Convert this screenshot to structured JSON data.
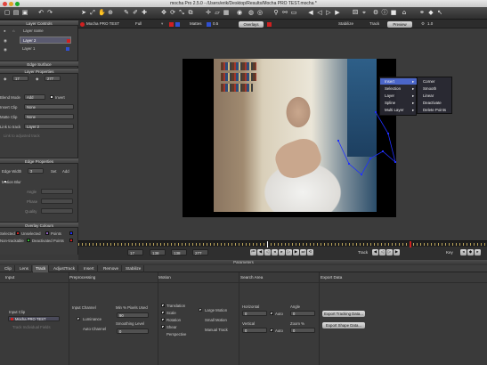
{
  "window": {
    "title": "mocha Pro 2.5.0 - /Users/erik/Desktop/Results/Mocha PRO TEST.mocha *"
  },
  "colors": {
    "accent_red": "#d02020",
    "accent_blue": "#3050d0",
    "spline": "#2030ff",
    "timeline_key": "#d9b94a"
  },
  "viewer_header": {
    "clip": "Mocha PRO TEST",
    "quality": "Full",
    "mattes_label": "Mattes",
    "zoom": "0.5",
    "overlays_label": "Overlays",
    "stabilize_label": "Stabilize",
    "track_label": "Track",
    "preview_label": "Preview",
    "fps": "1.0"
  },
  "layer_controls": {
    "header": "Layer Controls",
    "column_label": "Layer name",
    "layers": [
      "Layer 2",
      "Layer 1"
    ]
  },
  "edge_surface": {
    "header": "Edge Surface"
  },
  "layer_properties": {
    "header": "Layer Properties",
    "in_value": "17",
    "out_value": "277",
    "blend_mode_label": "Blend Mode",
    "blend_mode_value": "Add",
    "invert_label": "Invert",
    "insert_clip_label": "Insert Clip",
    "insert_clip_value": "None",
    "matte_clip_label": "Matte Clip",
    "matte_clip_value": "None",
    "link_to_track_label": "Link to track",
    "link_to_track_value": "Layer 2",
    "hint": "Link to adjusted track"
  },
  "edge_properties": {
    "header": "Edge Properties",
    "edge_width_label": "Edge Width",
    "edge_width_value": "3",
    "set_label": "Set",
    "add_label": "Add",
    "motion_blur_label": "Motion Blur",
    "angle_label": "Angle",
    "phase_label": "Phase",
    "quality_label": "Quality"
  },
  "overlay_colours": {
    "header": "Overlay Colours",
    "selected_label": "Selected",
    "unselected_label": "Unselected",
    "points_label": "Points",
    "nontrackable_label": "Non-trackable",
    "deactivated_points_label": "Deactivated Points"
  },
  "context_menu": {
    "items": [
      "Insert",
      "Selection",
      "Layer",
      "Spline",
      "Multi Layer"
    ],
    "submenu": [
      "Corner",
      "Smooth",
      "Linear",
      "Deactivate",
      "Delete Points"
    ]
  },
  "timeline": {
    "in_frame": "17",
    "start": "138",
    "current": "138",
    "end": "277",
    "track_label": "Track",
    "key_label": "Key"
  },
  "parameters": {
    "header": "Parameters",
    "tabs": [
      "Clip",
      "Lens",
      "Track",
      "AdjustTrack",
      "Insert",
      "Remove",
      "Stabilize"
    ],
    "active_tab": "Track",
    "sections": {
      "input": "Input",
      "preprocessing": "Preprocessing",
      "motion": "Motion",
      "search_area": "Search Area",
      "export_data": "Export Data"
    },
    "input_clip_label": "Input Clip",
    "input_clip_value": "Mocha PRO TEST",
    "track_individual_fields": "Track Individual Fields",
    "input_channel_label": "Input Channel",
    "luminance_label": "Luminance",
    "auto_channel_label": "Auto Channel",
    "min_pixels_label": "Min % Pixels Used",
    "min_pixels_value": "90",
    "smoothing_label": "Smoothing Level",
    "smoothing_value": "0",
    "translation_label": "Translation",
    "scale_label": "Scale",
    "rotation_label": "Rotation",
    "shear_label": "Shear",
    "perspective_label": "Perspective",
    "large_motion_label": "Large Motion",
    "small_motion_label": "Small Motion",
    "manual_track_label": "Manual Track",
    "horizontal_label": "Horizontal",
    "horizontal_value": "0",
    "vertical_label": "Vertical",
    "vertical_value": "0",
    "auto_label": "Auto",
    "angle_label": "Angle",
    "angle_value": "0",
    "zoom_label": "Zoom %",
    "zoom_value": "0",
    "export_tracking_label": "Export Tracking Data...",
    "export_shape_label": "Export Shape Data..."
  }
}
